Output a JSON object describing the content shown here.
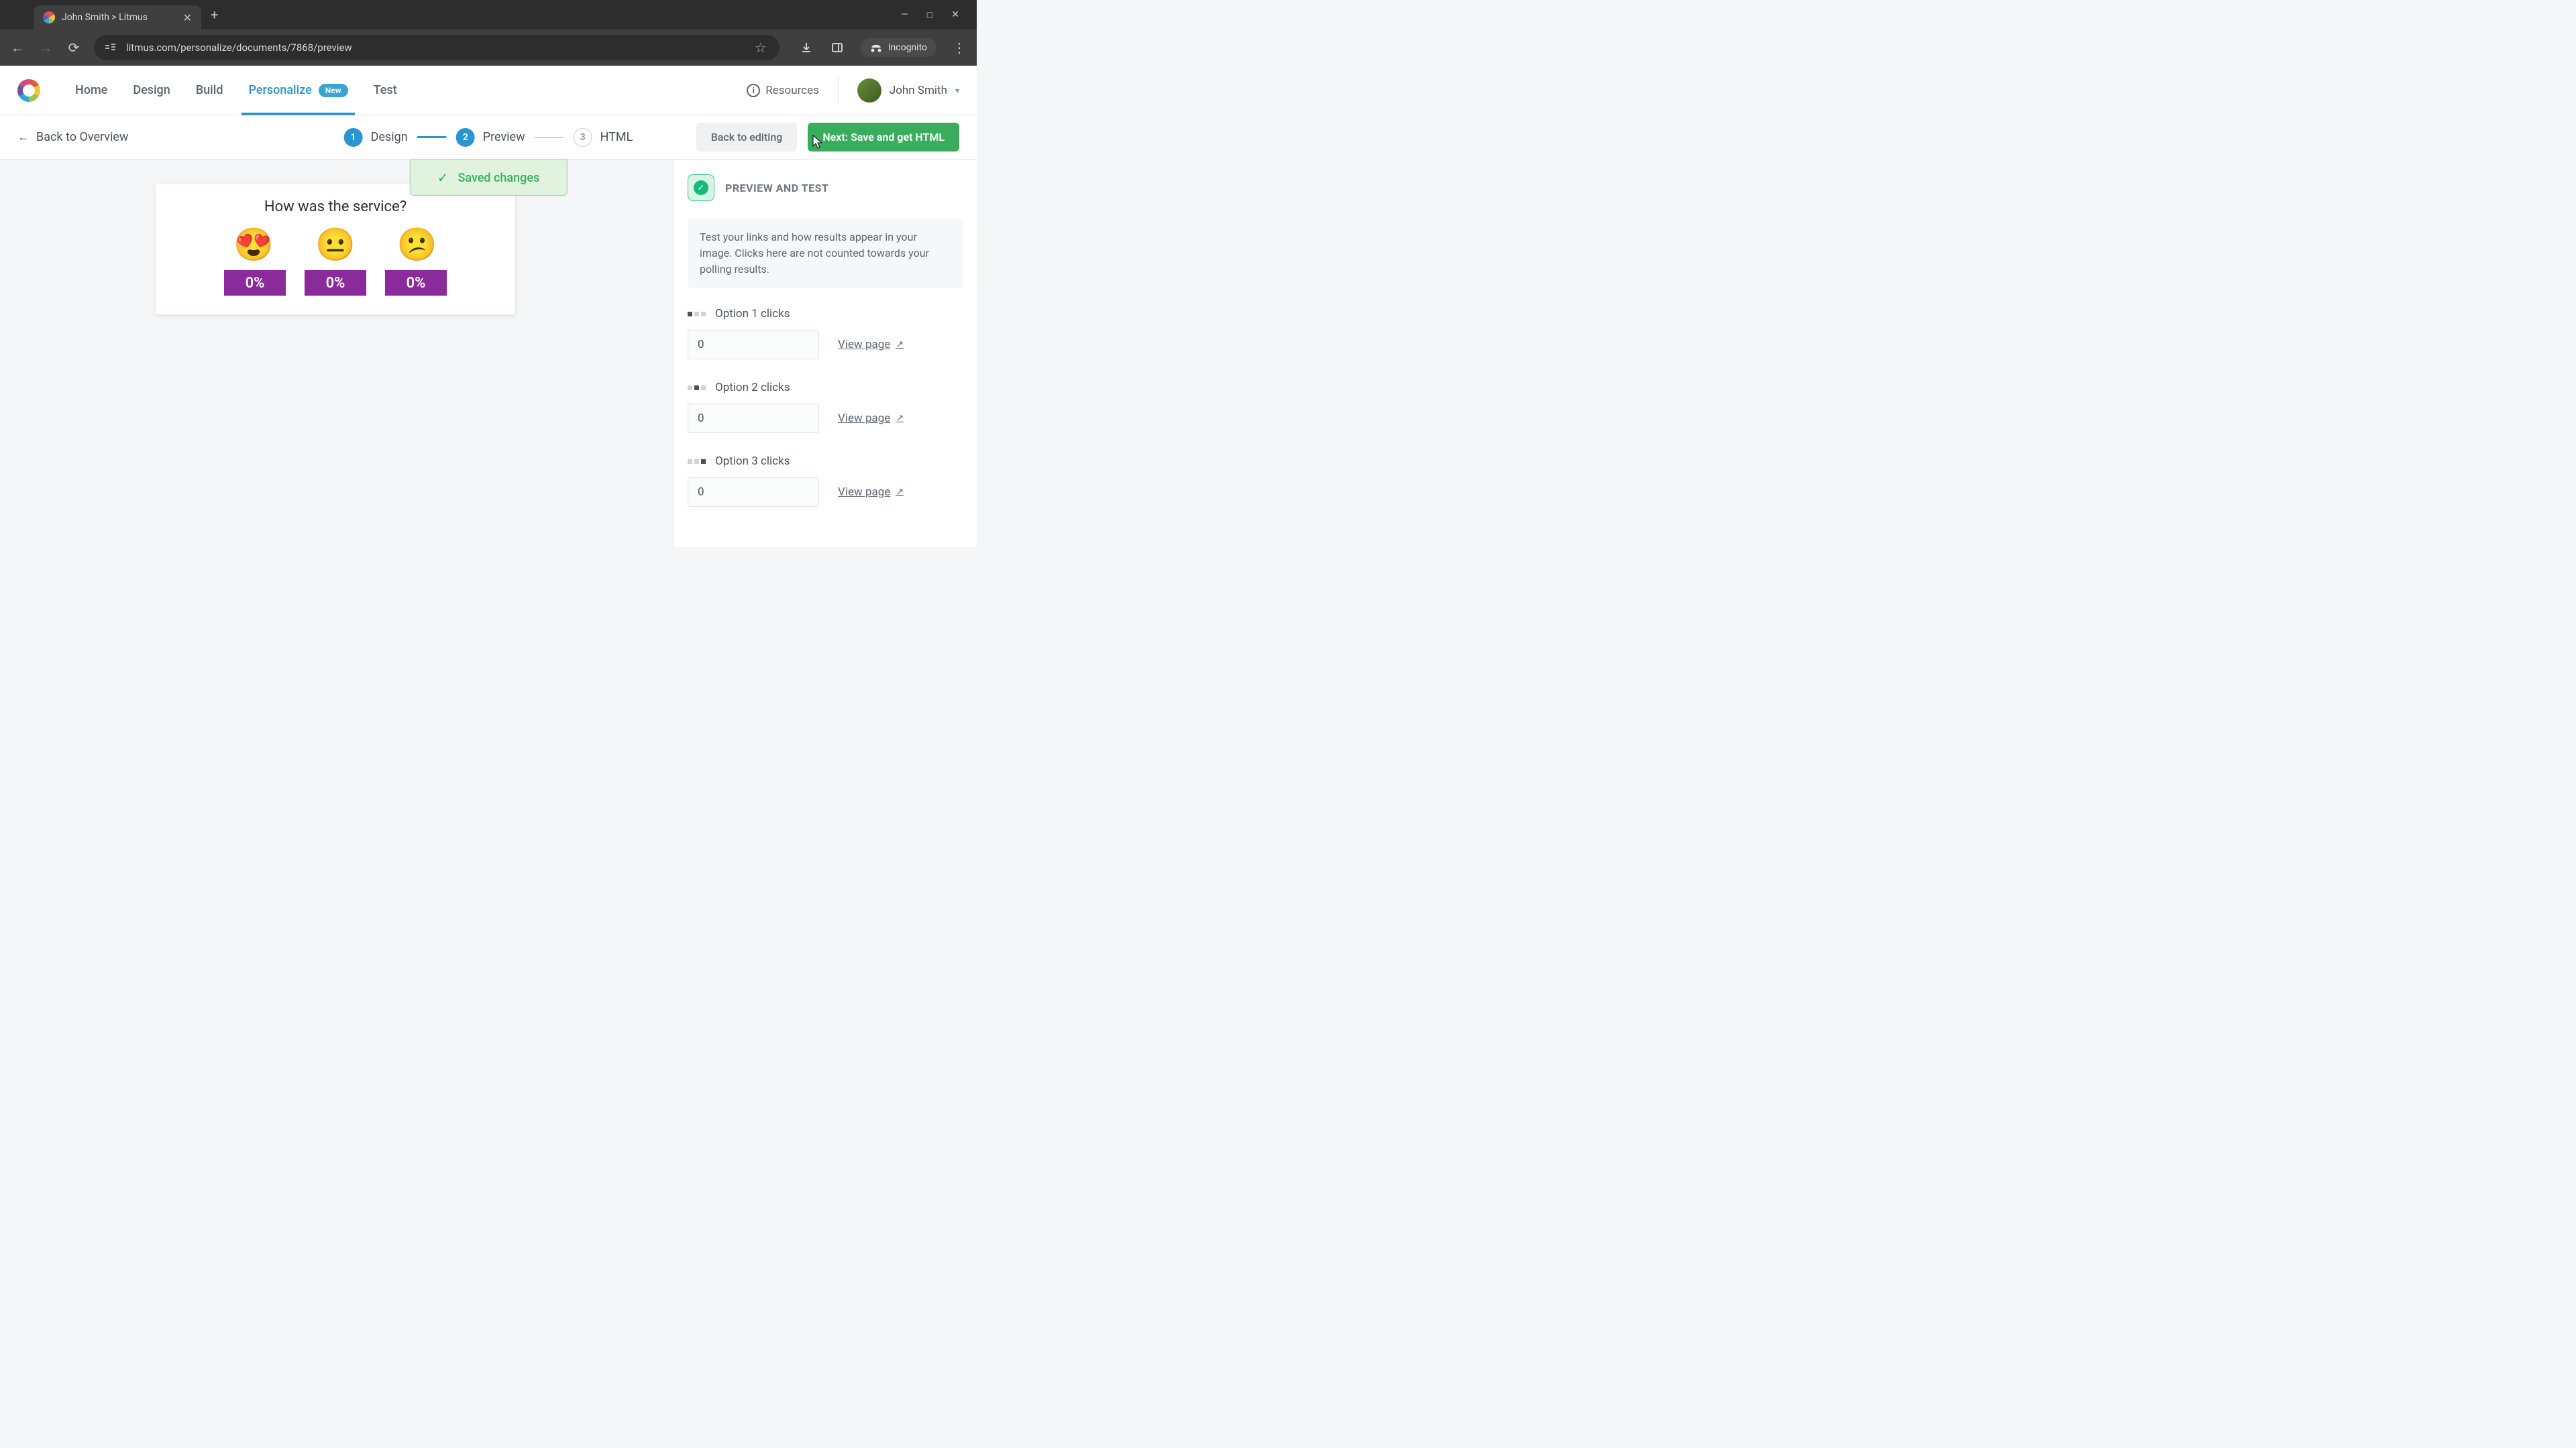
{
  "browser": {
    "tab_title": "John Smith > Litmus",
    "url": "litmus.com/personalize/documents/7868/preview",
    "incognito_label": "Incognito"
  },
  "nav": {
    "items": [
      "Home",
      "Design",
      "Build",
      "Personalize",
      "Test"
    ],
    "badge": "New",
    "resources": "Resources",
    "user": "John Smith"
  },
  "subheader": {
    "back": "Back to Overview",
    "steps": [
      {
        "num": "1",
        "label": "Design"
      },
      {
        "num": "2",
        "label": "Preview"
      },
      {
        "num": "3",
        "label": "HTML"
      }
    ],
    "btn_secondary": "Back to editing",
    "btn_primary": "Next: Save and get HTML"
  },
  "toast": "Saved changes",
  "preview": {
    "title": "How was the service?",
    "emojis": [
      "😍",
      "😐",
      "😕"
    ],
    "percents": [
      "0%",
      "0%",
      "0%"
    ]
  },
  "panel": {
    "title": "PREVIEW AND TEST",
    "desc": "Test your links and how results appear in your image. Clicks here are not counted towards your polling results.",
    "options": [
      {
        "label": "Option 1 clicks",
        "value": "0",
        "link": "View page",
        "active": 0
      },
      {
        "label": "Option 2 clicks",
        "value": "0",
        "link": "View page",
        "active": 1
      },
      {
        "label": "Option 3 clicks",
        "value": "0",
        "link": "View page",
        "active": 2
      }
    ]
  }
}
